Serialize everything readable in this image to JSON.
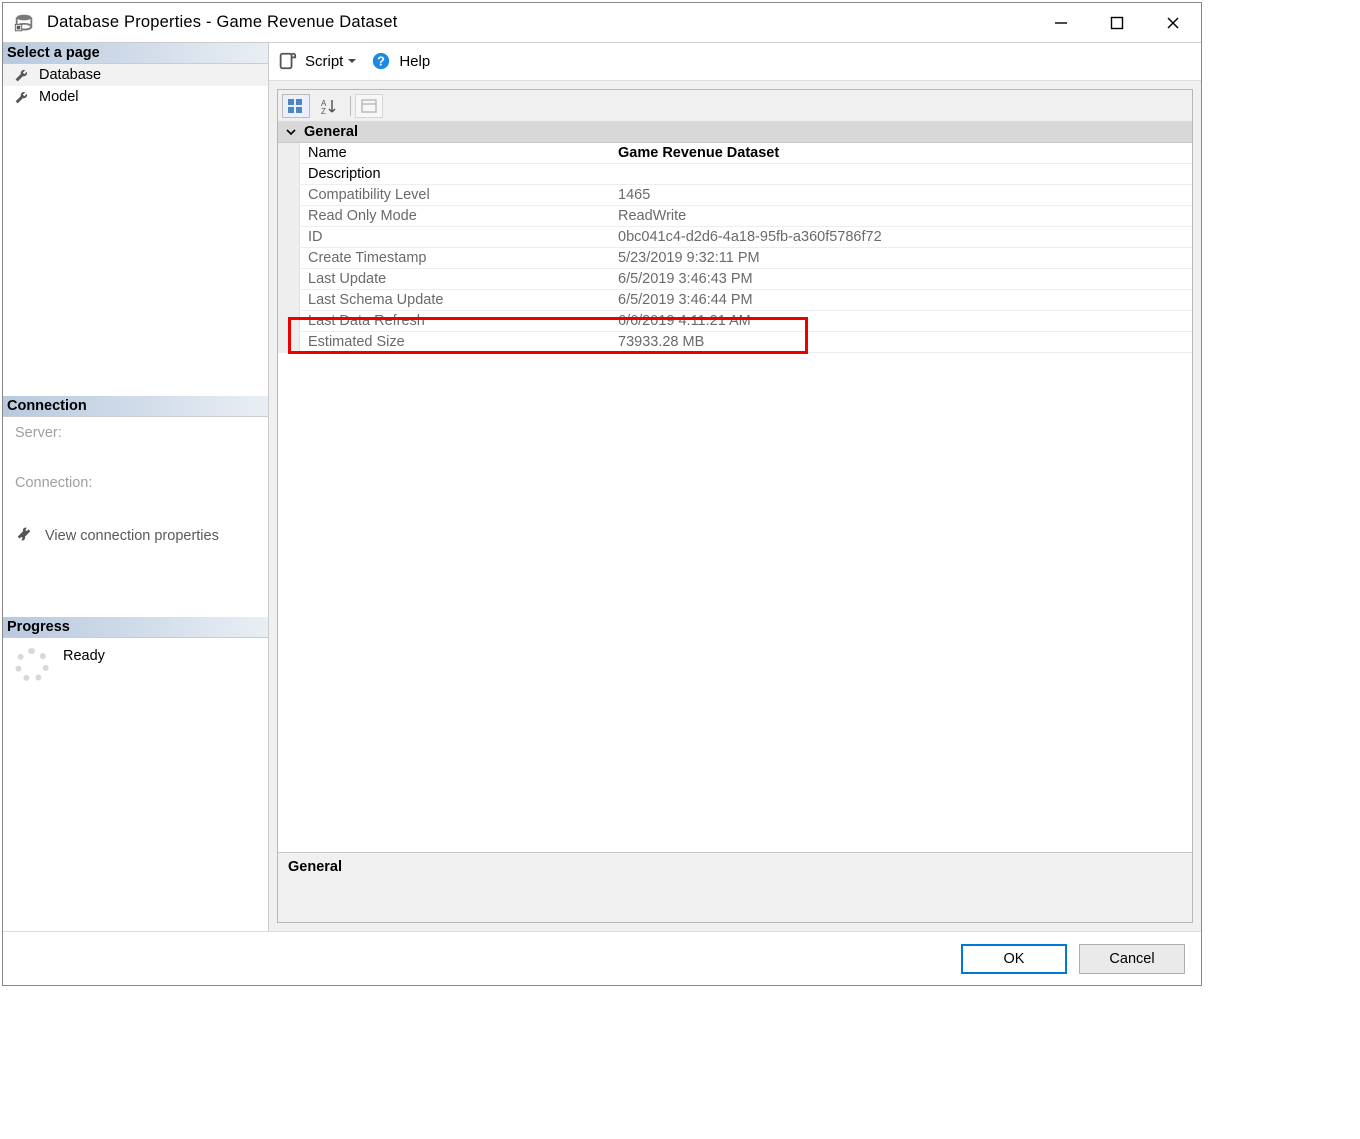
{
  "titlebar": {
    "title": "Database Properties - Game Revenue Dataset"
  },
  "sidebar": {
    "select_page_header": "Select a page",
    "pages": [
      {
        "label": "Database",
        "selected": true
      },
      {
        "label": "Model",
        "selected": false
      }
    ],
    "connection_header": "Connection",
    "server_label": "Server:",
    "connection_label": "Connection:",
    "view_props_link": "View connection properties",
    "progress_header": "Progress",
    "progress_status": "Ready"
  },
  "toolbar": {
    "script_label": "Script",
    "help_label": "Help"
  },
  "property_grid": {
    "category_header": "General",
    "rows": [
      {
        "label": "Name",
        "value": "Game Revenue Dataset",
        "readonly": false,
        "bold_value": true
      },
      {
        "label": "Description",
        "value": "",
        "readonly": false,
        "bold_value": false
      },
      {
        "label": "Compatibility Level",
        "value": "1465",
        "readonly": true,
        "bold_value": false
      },
      {
        "label": "Read Only Mode",
        "value": "ReadWrite",
        "readonly": true,
        "bold_value": false
      },
      {
        "label": "ID",
        "value": "0bc041c4-d2d6-4a18-95fb-a360f5786f72",
        "readonly": true,
        "bold_value": false
      },
      {
        "label": "Create Timestamp",
        "value": "5/23/2019 9:32:11 PM",
        "readonly": true,
        "bold_value": false
      },
      {
        "label": "Last Update",
        "value": "6/5/2019 3:46:43 PM",
        "readonly": true,
        "bold_value": false
      },
      {
        "label": "Last Schema Update",
        "value": "6/5/2019 3:46:44 PM",
        "readonly": true,
        "bold_value": false
      },
      {
        "label": "Last Data Refresh",
        "value": "6/6/2019 4:11:21 AM",
        "readonly": true,
        "bold_value": false
      },
      {
        "label": "Estimated Size",
        "value": "73933.28 MB",
        "readonly": true,
        "bold_value": false
      }
    ],
    "help_section_label": "General",
    "highlighted_row_index": 9
  },
  "footer": {
    "ok_label": "OK",
    "cancel_label": "Cancel"
  }
}
